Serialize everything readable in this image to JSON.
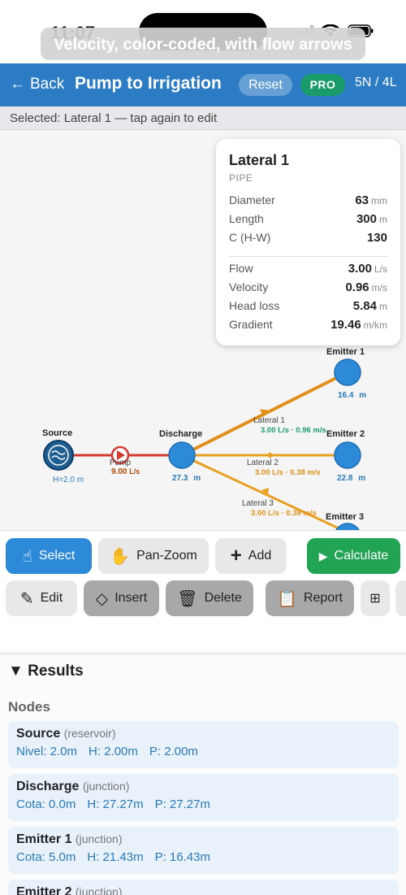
{
  "status": {
    "time": "11:07"
  },
  "toast": "Velocity, color-coded, with flow arrows",
  "nav": {
    "back_label": "Back",
    "title": "Pump to Irrigation",
    "reset_label": "Reset",
    "pro_label": "PRO",
    "counts": "5N / 4L"
  },
  "selection_text": "Selected: Lateral 1 — tap again to edit",
  "network": {
    "nodes": [
      {
        "label": "Source",
        "value": "H=2.0 m"
      },
      {
        "label": "Discharge",
        "value": "27.3",
        "unit": "m"
      },
      {
        "label": "Emitter 1",
        "value": "16.4",
        "unit": "m"
      },
      {
        "label": "Emitter 2",
        "value": "22.8",
        "unit": "m"
      },
      {
        "label": "Emitter 3"
      }
    ],
    "links": [
      {
        "label": "Pump",
        "flow": "9.00",
        "unit": "L/s"
      },
      {
        "label": "Lateral 1",
        "info": "3.00 L/s · 0.96 m/s"
      },
      {
        "label": "Lateral 2",
        "info": "3.00 L/s · 0.38 m/s"
      },
      {
        "label": "Lateral 3",
        "info": "3.00 L/s · 0.38 m/s"
      }
    ]
  },
  "properties": {
    "title": "Lateral 1",
    "type": "PIPE",
    "inputs": [
      {
        "label": "Diameter",
        "value": "63",
        "unit": "mm"
      },
      {
        "label": "Length",
        "value": "300",
        "unit": "m"
      },
      {
        "label": "C (H-W)",
        "value": "130",
        "unit": ""
      }
    ],
    "outputs": [
      {
        "label": "Flow",
        "value": "3.00",
        "unit": "L/s"
      },
      {
        "label": "Velocity",
        "value": "0.96",
        "unit": "m/s"
      },
      {
        "label": "Head loss",
        "value": "5.84",
        "unit": "m"
      },
      {
        "label": "Gradient",
        "value": "19.46",
        "unit": "m/km"
      }
    ]
  },
  "toolbar": {
    "select": "Select",
    "panzoom": "Pan-Zoom",
    "add": "Add",
    "calculate": "Calculate",
    "edit": "Edit",
    "insert": "Insert",
    "delete": "Delete",
    "report": "Report"
  },
  "results": {
    "heading": "Results",
    "nodes_label": "Nodes",
    "cards": [
      {
        "name": "Source",
        "type": "(reservoir)",
        "v1": "Nivel: 2.0m",
        "v2": "H: 2.00m",
        "v3": "P: 2.00m"
      },
      {
        "name": "Discharge",
        "type": "(junction)",
        "v1": "Cota: 0.0m",
        "v2": "H: 27.27m",
        "v3": "P: 27.27m"
      },
      {
        "name": "Emitter 1",
        "type": "(junction)",
        "v1": "Cota: 5.0m",
        "v2": "H: 21.43m",
        "v3": "P: 16.43m"
      },
      {
        "name": "Emitter 2",
        "type": "(junction)",
        "v1": "",
        "v2": "",
        "v3": ""
      }
    ]
  },
  "colors": {
    "accent": "#2b7cc4",
    "pro": "#1a9b6a",
    "calc": "#22a455",
    "pump": "#d33a2f",
    "pipe_high": "#e0901a",
    "pipe_low": "#e8a020",
    "node": "#2c8ad8"
  }
}
